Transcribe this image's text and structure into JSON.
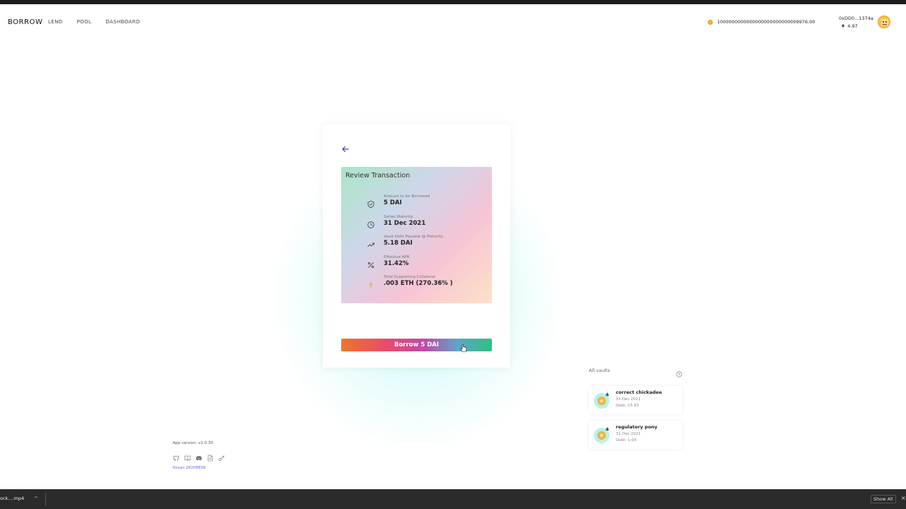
{
  "header": {
    "brand": "BORROW",
    "nav": [
      "LEND",
      "POOL",
      "DASHBOARD"
    ],
    "balance": "1000000000000000000000000009976.00",
    "account": "0xDD0...1374a",
    "eth_balance": "4.97"
  },
  "review": {
    "title": "Review Transaction",
    "rows": [
      {
        "label": "Amount to be Borrowed",
        "value": "5 DAI",
        "icon": "shield-icon"
      },
      {
        "label": "Series Maturity",
        "value": "31 Dec 2021",
        "icon": "clock-icon"
      },
      {
        "label": "Vault Debt Payable @ Maturity",
        "value": "5.18 DAI",
        "icon": "trend-up-icon"
      },
      {
        "label": "Effective APR",
        "value": "31.42%",
        "icon": "percent-icon"
      },
      {
        "label": "Total Supporting Collateral",
        "value": ".003 ETH (270.36% )",
        "icon": "eth-icon"
      }
    ]
  },
  "borrow_button": "Borrow 5 DAI",
  "vaults": {
    "title": "All vaults",
    "items": [
      {
        "name": "correct chickadee",
        "date": "31 Dec 2021",
        "debt": "Debt: 15.63"
      },
      {
        "name": "regulatory pony",
        "date": "31 Dec 2021",
        "debt": "Debt: 1.04"
      }
    ]
  },
  "footer": {
    "app_version": "App version: v2.0.30",
    "network": "Kovan  28208858"
  },
  "download_bar": {
    "file": "ock....mp4",
    "caret": "^",
    "show_all": "Show All",
    "close": "×"
  },
  "colors": {
    "accent_link": "#6a6ad8",
    "dai_gold": "#f0b43c",
    "glow": "#78f0eb"
  }
}
